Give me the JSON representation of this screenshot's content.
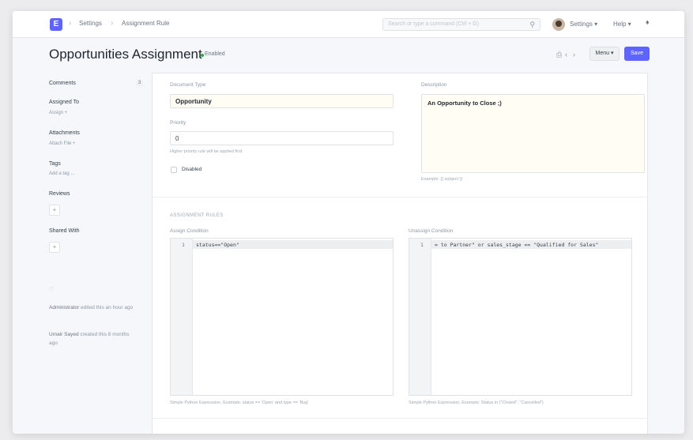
{
  "navbar": {
    "logo_letter": "E",
    "breadcrumbs": [
      "Settings",
      "Assignment Rule"
    ],
    "search_placeholder": "Search or type a command (Ctrl + G)",
    "settings_label": "Settings ▾",
    "help_label": "Help ▾"
  },
  "page": {
    "title": "Opportunities Assignment",
    "status": "Enabled",
    "menu_label": "Menu ▾",
    "save_label": "Save"
  },
  "sidebar": {
    "comments_label": "Comments",
    "comments_count": "3",
    "assigned_to_label": "Assigned To",
    "assign_link": "Assign +",
    "attachments_label": "Attachments",
    "attach_link": "Attach File +",
    "tags_label": "Tags",
    "add_tag_link": "Add a tag ...",
    "reviews_label": "Reviews",
    "shared_with_label": "Shared With",
    "activity": [
      {
        "user": "Administrator",
        "text": " edited this an hour ago"
      },
      {
        "user": "Umair Sayed",
        "text": " created this 8 months ago"
      }
    ]
  },
  "form": {
    "document_type_label": "Document Type",
    "document_type_value": "Opportunity",
    "priority_label": "Priority",
    "priority_value": "0",
    "priority_help": "Higher priority rule will be applied first",
    "disabled_label": "Disabled",
    "description_label": "Description",
    "description_value": "An Opportunity to Close ;)",
    "description_help": "Example: {{ subject }}",
    "section_title": "ASSIGNMENT RULES",
    "assign_condition_label": "Assign Condition",
    "assign_condition_line_no": "1",
    "assign_condition_code": "status==\"Open\"",
    "assign_condition_help": "Simple Python Expression, Example: status == 'Open' and type == 'Bug'",
    "unassign_condition_label": "Unassign Condition",
    "unassign_condition_line_no": "1",
    "unassign_condition_code": "= to Partner\" or sales_stage == \"Qualified for Sales\"",
    "unassign_condition_help": "Simple Python Expression, Example: Status in (\"Closed\", \"Cancelled\")"
  },
  "colors": {
    "primary": "#5e64ff",
    "enabled_dot": "#28a745"
  }
}
